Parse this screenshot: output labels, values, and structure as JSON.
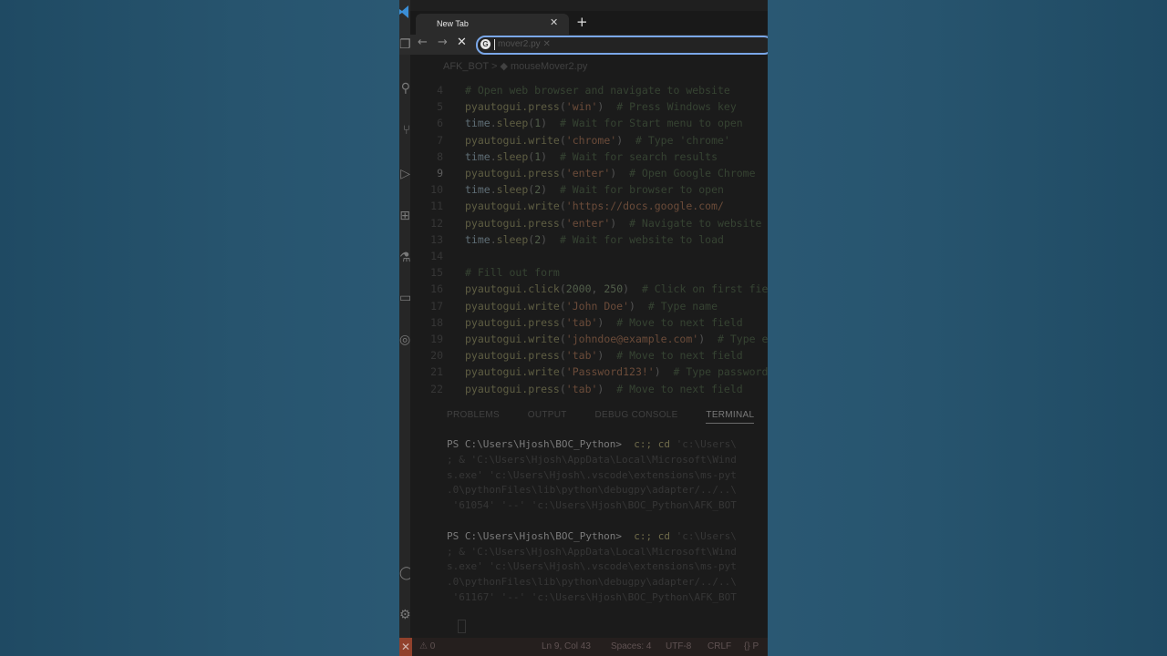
{
  "browser": {
    "tab_title": "New Tab",
    "tab_close": "✕",
    "new_tab": "+",
    "back": "←",
    "forward": "→",
    "stop": "✕",
    "omnibox_icon": "G",
    "omnibox_ghost": "mover2.py  ✕"
  },
  "editor": {
    "breadcrumb": "AFK_BOT  >  ◆  mouseMover2.py",
    "lines": [
      {
        "n": "4",
        "html": "<span class='cm'># Open web browser and navigate to website</span>"
      },
      {
        "n": "5",
        "html": "<span class='fn'>pyautogui.press</span><span class='pl'>(</span><span class='str'>'win'</span><span class='pl'>)</span>  <span class='cm'># Press Windows key</span>"
      },
      {
        "n": "6",
        "html": "<span class='obj'>time</span><span class='pl'>.</span><span class='fn'>sleep</span><span class='pl'>(</span><span class='num'>1</span><span class='pl'>)</span>  <span class='cm'># Wait for Start menu to open</span>"
      },
      {
        "n": "7",
        "html": "<span class='fn'>pyautogui.write</span><span class='pl'>(</span><span class='str'>'chrome'</span><span class='pl'>)</span>  <span class='cm'># Type 'chrome'</span>"
      },
      {
        "n": "8",
        "html": "<span class='obj'>time</span><span class='pl'>.</span><span class='fn'>sleep</span><span class='pl'>(</span><span class='num'>1</span><span class='pl'>)</span>  <span class='cm'># Wait for search results</span>"
      },
      {
        "n": "9",
        "active": true,
        "html": "<span class='fn'>pyautogui.press</span><span class='pl'>(</span><span class='str'>'enter'</span><span class='pl'>)</span>  <span class='cm'># Open Google Chrome</span>"
      },
      {
        "n": "10",
        "html": "<span class='obj'>time</span><span class='pl'>.</span><span class='fn'>sleep</span><span class='pl'>(</span><span class='num'>2</span><span class='pl'>)</span>  <span class='cm'># Wait for browser to open</span>"
      },
      {
        "n": "11",
        "html": "<span class='fn'>pyautogui.write</span><span class='pl'>(</span><span class='str'>'https://docs.google.com/</span>"
      },
      {
        "n": "12",
        "html": "<span class='fn'>pyautogui.press</span><span class='pl'>(</span><span class='str'>'enter'</span><span class='pl'>)</span>  <span class='cm'># Navigate to website</span>"
      },
      {
        "n": "13",
        "html": "<span class='obj'>time</span><span class='pl'>.</span><span class='fn'>sleep</span><span class='pl'>(</span><span class='num'>2</span><span class='pl'>)</span>  <span class='cm'># Wait for website to load</span>"
      },
      {
        "n": "14",
        "html": ""
      },
      {
        "n": "15",
        "html": "<span class='cm'># Fill out form</span>"
      },
      {
        "n": "16",
        "html": "<span class='fn'>pyautogui.click</span><span class='pl'>(</span><span class='num'>2000</span><span class='pl'>, </span><span class='num'>250</span><span class='pl'>)</span>  <span class='cm'># Click on first field</span>"
      },
      {
        "n": "17",
        "html": "<span class='fn'>pyautogui.write</span><span class='pl'>(</span><span class='str'>'John Doe'</span><span class='pl'>)</span>  <span class='cm'># Type name</span>"
      },
      {
        "n": "18",
        "html": "<span class='fn'>pyautogui.press</span><span class='pl'>(</span><span class='str'>'tab'</span><span class='pl'>)</span>  <span class='cm'># Move to next field</span>"
      },
      {
        "n": "19",
        "html": "<span class='fn'>pyautogui.write</span><span class='pl'>(</span><span class='str'>'johndoe@example.com'</span><span class='pl'>)</span>  <span class='cm'># Type email</span>"
      },
      {
        "n": "20",
        "html": "<span class='fn'>pyautogui.press</span><span class='pl'>(</span><span class='str'>'tab'</span><span class='pl'>)</span>  <span class='cm'># Move to next field</span>"
      },
      {
        "n": "21",
        "html": "<span class='fn'>pyautogui.write</span><span class='pl'>(</span><span class='str'>'Password123!'</span><span class='pl'>)</span>  <span class='cm'># Type password</span>"
      },
      {
        "n": "22",
        "html": "<span class='fn'>pyautogui.press</span><span class='pl'>(</span><span class='str'>'tab'</span><span class='pl'>)</span>  <span class='cm'># Move to next field</span>"
      }
    ]
  },
  "panel": {
    "tabs": [
      "PROBLEMS",
      "OUTPUT",
      "DEBUG CONSOLE",
      "TERMINAL"
    ],
    "terminal": [
      {
        "prompt": "PS C:\\Users\\Hjosh\\BOC_Python> ",
        "cmd": " c:; cd ",
        "rest": "'c:\\Users\\"
      },
      {
        "text": "; & 'C:\\Users\\Hjosh\\AppData\\Local\\Microsoft\\Wind"
      },
      {
        "text": "s.exe' 'c:\\Users\\Hjosh\\.vscode\\extensions\\ms-pyt"
      },
      {
        "text": ".0\\pythonFiles\\lib\\python\\debugpy\\adapter/../..\\"
      },
      {
        "text": " '61054' '--' 'c:\\Users\\Hjosh\\BOC_Python\\AFK_BOT"
      },
      {
        "text": ""
      },
      {
        "prompt": "PS C:\\Users\\Hjosh\\BOC_Python> ",
        "cmd": " c:; cd ",
        "rest": "'c:\\Users\\"
      },
      {
        "text": "; & 'C:\\Users\\Hjosh\\AppData\\Local\\Microsoft\\Wind"
      },
      {
        "text": "s.exe' 'c:\\Users\\Hjosh\\.vscode\\extensions\\ms-pyt"
      },
      {
        "text": ".0\\pythonFiles\\lib\\python\\debugpy\\adapter/../..\\"
      },
      {
        "text": " '61167' '--' 'c:\\Users\\Hjosh\\BOC_Python\\AFK_BOT"
      }
    ]
  },
  "status": {
    "errors": "⚠ 0",
    "position": "Ln 9, Col 43",
    "spaces": "Spaces: 4",
    "encoding": "UTF-8",
    "eol": "CRLF",
    "language": "{} P"
  }
}
